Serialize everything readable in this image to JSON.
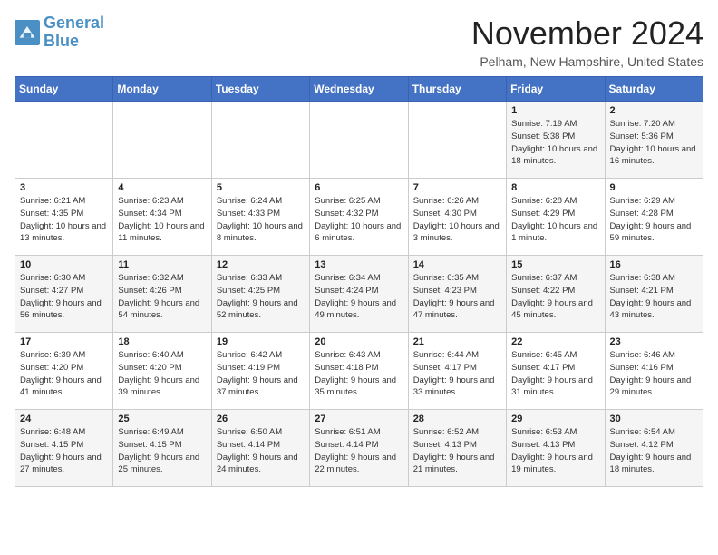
{
  "logo": {
    "line1": "General",
    "line2": "Blue"
  },
  "title": "November 2024",
  "location": "Pelham, New Hampshire, United States",
  "days_of_week": [
    "Sunday",
    "Monday",
    "Tuesday",
    "Wednesday",
    "Thursday",
    "Friday",
    "Saturday"
  ],
  "weeks": [
    [
      {
        "day": "",
        "info": ""
      },
      {
        "day": "",
        "info": ""
      },
      {
        "day": "",
        "info": ""
      },
      {
        "day": "",
        "info": ""
      },
      {
        "day": "",
        "info": ""
      },
      {
        "day": "1",
        "info": "Sunrise: 7:19 AM\nSunset: 5:38 PM\nDaylight: 10 hours and 18 minutes."
      },
      {
        "day": "2",
        "info": "Sunrise: 7:20 AM\nSunset: 5:36 PM\nDaylight: 10 hours and 16 minutes."
      }
    ],
    [
      {
        "day": "3",
        "info": "Sunrise: 6:21 AM\nSunset: 4:35 PM\nDaylight: 10 hours and 13 minutes."
      },
      {
        "day": "4",
        "info": "Sunrise: 6:23 AM\nSunset: 4:34 PM\nDaylight: 10 hours and 11 minutes."
      },
      {
        "day": "5",
        "info": "Sunrise: 6:24 AM\nSunset: 4:33 PM\nDaylight: 10 hours and 8 minutes."
      },
      {
        "day": "6",
        "info": "Sunrise: 6:25 AM\nSunset: 4:32 PM\nDaylight: 10 hours and 6 minutes."
      },
      {
        "day": "7",
        "info": "Sunrise: 6:26 AM\nSunset: 4:30 PM\nDaylight: 10 hours and 3 minutes."
      },
      {
        "day": "8",
        "info": "Sunrise: 6:28 AM\nSunset: 4:29 PM\nDaylight: 10 hours and 1 minute."
      },
      {
        "day": "9",
        "info": "Sunrise: 6:29 AM\nSunset: 4:28 PM\nDaylight: 9 hours and 59 minutes."
      }
    ],
    [
      {
        "day": "10",
        "info": "Sunrise: 6:30 AM\nSunset: 4:27 PM\nDaylight: 9 hours and 56 minutes."
      },
      {
        "day": "11",
        "info": "Sunrise: 6:32 AM\nSunset: 4:26 PM\nDaylight: 9 hours and 54 minutes."
      },
      {
        "day": "12",
        "info": "Sunrise: 6:33 AM\nSunset: 4:25 PM\nDaylight: 9 hours and 52 minutes."
      },
      {
        "day": "13",
        "info": "Sunrise: 6:34 AM\nSunset: 4:24 PM\nDaylight: 9 hours and 49 minutes."
      },
      {
        "day": "14",
        "info": "Sunrise: 6:35 AM\nSunset: 4:23 PM\nDaylight: 9 hours and 47 minutes."
      },
      {
        "day": "15",
        "info": "Sunrise: 6:37 AM\nSunset: 4:22 PM\nDaylight: 9 hours and 45 minutes."
      },
      {
        "day": "16",
        "info": "Sunrise: 6:38 AM\nSunset: 4:21 PM\nDaylight: 9 hours and 43 minutes."
      }
    ],
    [
      {
        "day": "17",
        "info": "Sunrise: 6:39 AM\nSunset: 4:20 PM\nDaylight: 9 hours and 41 minutes."
      },
      {
        "day": "18",
        "info": "Sunrise: 6:40 AM\nSunset: 4:20 PM\nDaylight: 9 hours and 39 minutes."
      },
      {
        "day": "19",
        "info": "Sunrise: 6:42 AM\nSunset: 4:19 PM\nDaylight: 9 hours and 37 minutes."
      },
      {
        "day": "20",
        "info": "Sunrise: 6:43 AM\nSunset: 4:18 PM\nDaylight: 9 hours and 35 minutes."
      },
      {
        "day": "21",
        "info": "Sunrise: 6:44 AM\nSunset: 4:17 PM\nDaylight: 9 hours and 33 minutes."
      },
      {
        "day": "22",
        "info": "Sunrise: 6:45 AM\nSunset: 4:17 PM\nDaylight: 9 hours and 31 minutes."
      },
      {
        "day": "23",
        "info": "Sunrise: 6:46 AM\nSunset: 4:16 PM\nDaylight: 9 hours and 29 minutes."
      }
    ],
    [
      {
        "day": "24",
        "info": "Sunrise: 6:48 AM\nSunset: 4:15 PM\nDaylight: 9 hours and 27 minutes."
      },
      {
        "day": "25",
        "info": "Sunrise: 6:49 AM\nSunset: 4:15 PM\nDaylight: 9 hours and 25 minutes."
      },
      {
        "day": "26",
        "info": "Sunrise: 6:50 AM\nSunset: 4:14 PM\nDaylight: 9 hours and 24 minutes."
      },
      {
        "day": "27",
        "info": "Sunrise: 6:51 AM\nSunset: 4:14 PM\nDaylight: 9 hours and 22 minutes."
      },
      {
        "day": "28",
        "info": "Sunrise: 6:52 AM\nSunset: 4:13 PM\nDaylight: 9 hours and 21 minutes."
      },
      {
        "day": "29",
        "info": "Sunrise: 6:53 AM\nSunset: 4:13 PM\nDaylight: 9 hours and 19 minutes."
      },
      {
        "day": "30",
        "info": "Sunrise: 6:54 AM\nSunset: 4:12 PM\nDaylight: 9 hours and 18 minutes."
      }
    ]
  ]
}
